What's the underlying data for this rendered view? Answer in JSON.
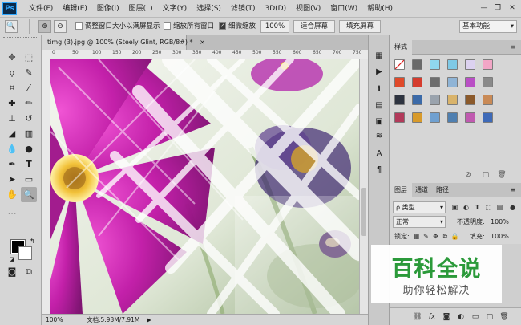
{
  "app": {
    "logo": "Ps"
  },
  "menu": [
    "文件(F)",
    "编辑(E)",
    "图像(I)",
    "图层(L)",
    "文字(Y)",
    "选择(S)",
    "滤镜(T)",
    "3D(D)",
    "视图(V)",
    "窗口(W)",
    "帮助(H)"
  ],
  "window_controls": {
    "minimize": "—",
    "restore": "❐",
    "close": "✕"
  },
  "options": {
    "resize_window_label": "调整窗口大小以满屏显示",
    "zoom_all_label": "缩放所有窗口",
    "scrubby_zoom_label": "细微缩放",
    "scrubby_zoom_checked": true,
    "btn_100": "100%",
    "btn_fit": "适合屏幕",
    "btn_fill": "填充屏幕",
    "workspace": "基本功能"
  },
  "document": {
    "tab_title": "timg (3).jpg @ 100% (Steely Glint, RGB/8#) *",
    "tab_close": "×",
    "ruler_ticks": [
      "0",
      "50",
      "100",
      "150",
      "200",
      "250",
      "300",
      "350",
      "400",
      "450",
      "500",
      "550",
      "600",
      "650",
      "700",
      "750"
    ],
    "zoom": "100%",
    "doc_size": "文档:5.93M/7.91M",
    "status_arrow": "▶"
  },
  "styles_panel": {
    "tab": "样式",
    "swatches": [
      [
        "#ffffff",
        "#6a6a6a",
        "#8fd8ef",
        "#7ec9e6",
        "#dcd2f0",
        "#f2a6c6"
      ],
      [
        "#e04a2a",
        "#d53c2e",
        "#6d6d6d",
        "#8fb4d6",
        "#b94fc5",
        "#8a8a8a"
      ],
      [
        "#2e3440",
        "#3b6aa8",
        "#9aa3ad",
        "#d9b36a",
        "#8b5a2b",
        "#c98a56"
      ],
      [
        "#b23a5a",
        "#d89a2a",
        "#6fa0d0",
        "#4f7fb0",
        "#c05ab0",
        "#3e6ab8"
      ]
    ]
  },
  "layers_panel": {
    "tabs": [
      "图层",
      "通道",
      "路径"
    ],
    "kind_filter": "ρ 类型",
    "blend_mode": "正常",
    "opacity_label": "不透明度:",
    "opacity_value": "100%",
    "lock_label": "锁定:",
    "fill_label": "填充:",
    "fill_value": "100%"
  },
  "watermark": {
    "title": "百科全说",
    "subtitle": "助你轻松解决"
  }
}
